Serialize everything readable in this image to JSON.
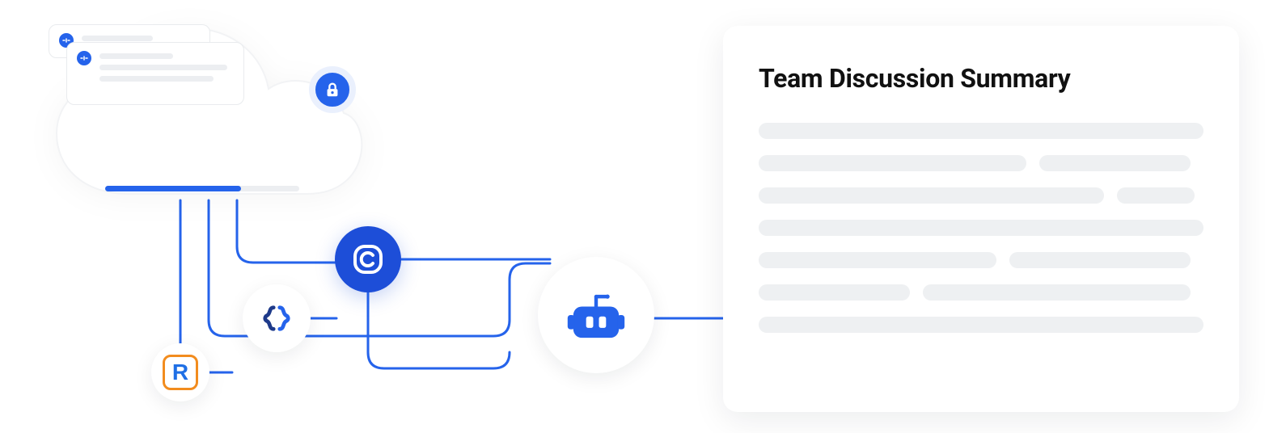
{
  "summary": {
    "title": "Team Discussion Summary"
  },
  "icons": {
    "lock": "lock-icon",
    "app_r": "r-app-icon",
    "app_o": "braces-app-icon",
    "app_c": "c-app-icon",
    "bot": "robot-icon",
    "r_letter": "R"
  },
  "colors": {
    "primary": "#2563eb",
    "primary_dark": "#1d4ed8",
    "orange": "#f28c1e",
    "placeholder": "#eef0f2",
    "line": "#eceef1"
  },
  "cloud": {
    "progress_percent": 70
  }
}
